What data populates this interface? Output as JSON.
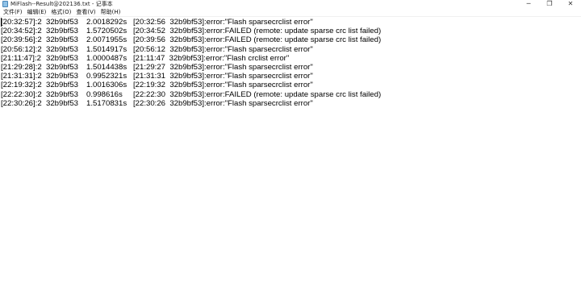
{
  "window": {
    "title": "MiFlash--Result@202136.txt - 记事本",
    "icon": "notepad-icon",
    "controls": {
      "minimize": "─",
      "maximize": "❐",
      "close": "✕"
    }
  },
  "menu": [
    "文件(F)",
    "编辑(E)",
    "格式(O)",
    "查看(V)",
    "帮助(H)"
  ],
  "lines": [
    {
      "time": "[20:32:57]:2",
      "serial": "32b9bf53",
      "duration": "2.0018292s",
      "msg": "[20:32:56  32b9bf53]:error:\"Flash sparsecrclist error\""
    },
    {
      "time": "[20:34:52]:2",
      "serial": "32b9bf53",
      "duration": "1.5720502s",
      "msg": "[20:34:52  32b9bf53]:error:FAILED (remote: update sparse crc list failed)"
    },
    {
      "time": "[20:39:56]:2",
      "serial": "32b9bf53",
      "duration": "2.0071955s",
      "msg": "[20:39:56  32b9bf53]:error:FAILED (remote: update sparse crc list failed)"
    },
    {
      "time": "[20:56:12]:2",
      "serial": "32b9bf53",
      "duration": "1.5014917s",
      "msg": "[20:56:12  32b9bf53]:error:\"Flash sparsecrclist error\""
    },
    {
      "time": "[21:11:47]:2",
      "serial": "32b9bf53",
      "duration": "1.0000487s",
      "msg": "[21:11:47  32b9bf53]:error:\"Flash crclist error\""
    },
    {
      "time": "[21:29:28]:2",
      "serial": "32b9bf53",
      "duration": "1.5014438s",
      "msg": "[21:29:27  32b9bf53]:error:\"Flash sparsecrclist error\""
    },
    {
      "time": "[21:31:31]:2",
      "serial": "32b9bf53",
      "duration": "0.9952321s",
      "msg": "[21:31:31  32b9bf53]:error:\"Flash sparsecrclist error\""
    },
    {
      "time": "[22:19:32]:2",
      "serial": "32b9bf53",
      "duration": "1.0016306s",
      "msg": "[22:19:32  32b9bf53]:error:\"Flash sparsecrclist error\""
    },
    {
      "time": "[22:22:30]:2",
      "serial": "32b9bf53",
      "duration": "0.998616s",
      "msg": "[22:22:30  32b9bf53]:error:FAILED (remote: update sparse crc list failed)"
    },
    {
      "time": "[22:30:26]:2",
      "serial": "32b9bf53",
      "duration": "1.5170831s",
      "msg": "[22:30:26  32b9bf53]:error:\"Flash sparsecrclist error\""
    }
  ]
}
